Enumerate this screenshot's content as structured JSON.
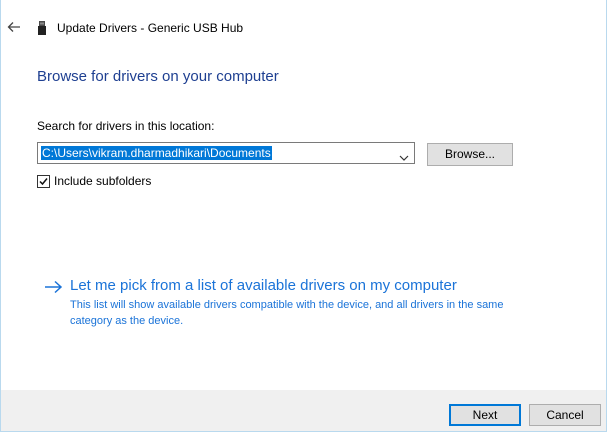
{
  "window": {
    "title": "Update Drivers - Generic USB Hub",
    "back_icon": "back-arrow-icon",
    "device_icon": "usb-device-icon"
  },
  "page": {
    "heading": "Browse for drivers on your computer"
  },
  "search": {
    "label": "Search for drivers in this location:",
    "path_value": "C:\\Users\\vikram.dharmadhikari\\Documents",
    "browse_label": "Browse...",
    "include_subfolders_label": "Include subfolders",
    "include_subfolders_checked": true
  },
  "pick_option": {
    "title": "Let me pick from a list of available drivers on my computer",
    "description": "This list will show available drivers compatible with the device, and all drivers in the same category as the device."
  },
  "footer": {
    "next_label": "Next",
    "cancel_label": "Cancel"
  },
  "colors": {
    "heading": "#1e3f91",
    "link": "#1a73d8",
    "selection": "#0078d7",
    "footer_bg": "#f0f0f0",
    "window_border": "#b9d9ee"
  }
}
